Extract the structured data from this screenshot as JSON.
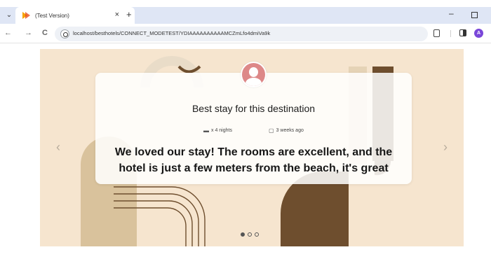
{
  "browser": {
    "tab": {
      "title": "(Test Version)",
      "close_glyph": "×"
    },
    "new_tab_glyph": "+",
    "window": {
      "minimize_glyph": "–"
    },
    "nav": {
      "back_glyph": "←",
      "forward_glyph": "→",
      "reload_glyph": "C"
    },
    "url": "localhost/besthotels/CONNECT_MODETEST/YDIAAAAAAAAAAMCZmLfo4dmiVa9k",
    "profile_initial": "A",
    "icons": [
      "chevron-down-icon",
      "site-info-icon",
      "extensions-icon",
      "side-panel-icon",
      "profile-avatar"
    ]
  },
  "page": {
    "review": {
      "heading": "Best stay for this destination",
      "stay_length": "x 4 nights",
      "posted": "3 weeks ago",
      "quote": "We loved our stay! The rooms are excellent, and the hotel is just a few meters from the beach, it's great"
    },
    "carousel": {
      "prev_glyph": "‹",
      "next_glyph": "›",
      "slides": 3,
      "active_slide": 1
    },
    "colors": {
      "banner": "#f6e5cf",
      "brown": "#6e4e2e",
      "tan": "#d9c29c",
      "avatar": "#dd8888"
    }
  }
}
